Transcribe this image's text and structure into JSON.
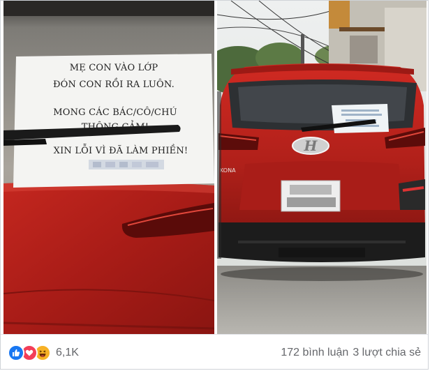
{
  "note_left": {
    "line1": "MẸ CON VÀO LỚP",
    "line2": "ĐÓN CON RỒI RA LUÔN.",
    "line3": "MONG CÁC BÁC/CÔ/CHÚ",
    "line4": "THÔNG CẢM!",
    "line5": "XIN LỖI VÌ ĐÃ LÀM PHIỀN!"
  },
  "car_badge": "KONA",
  "reactions": {
    "icons": [
      "like-icon",
      "love-icon",
      "haha-icon"
    ],
    "count": "6,1K"
  },
  "stats": {
    "comments": "172 bình luận",
    "shares": "3 lượt chia sẻ"
  },
  "colors": {
    "like": "#1877f2",
    "love": "#f33e58",
    "haha": "#f7b125",
    "car_red": "#b5221d",
    "muted_text": "#65676b"
  }
}
